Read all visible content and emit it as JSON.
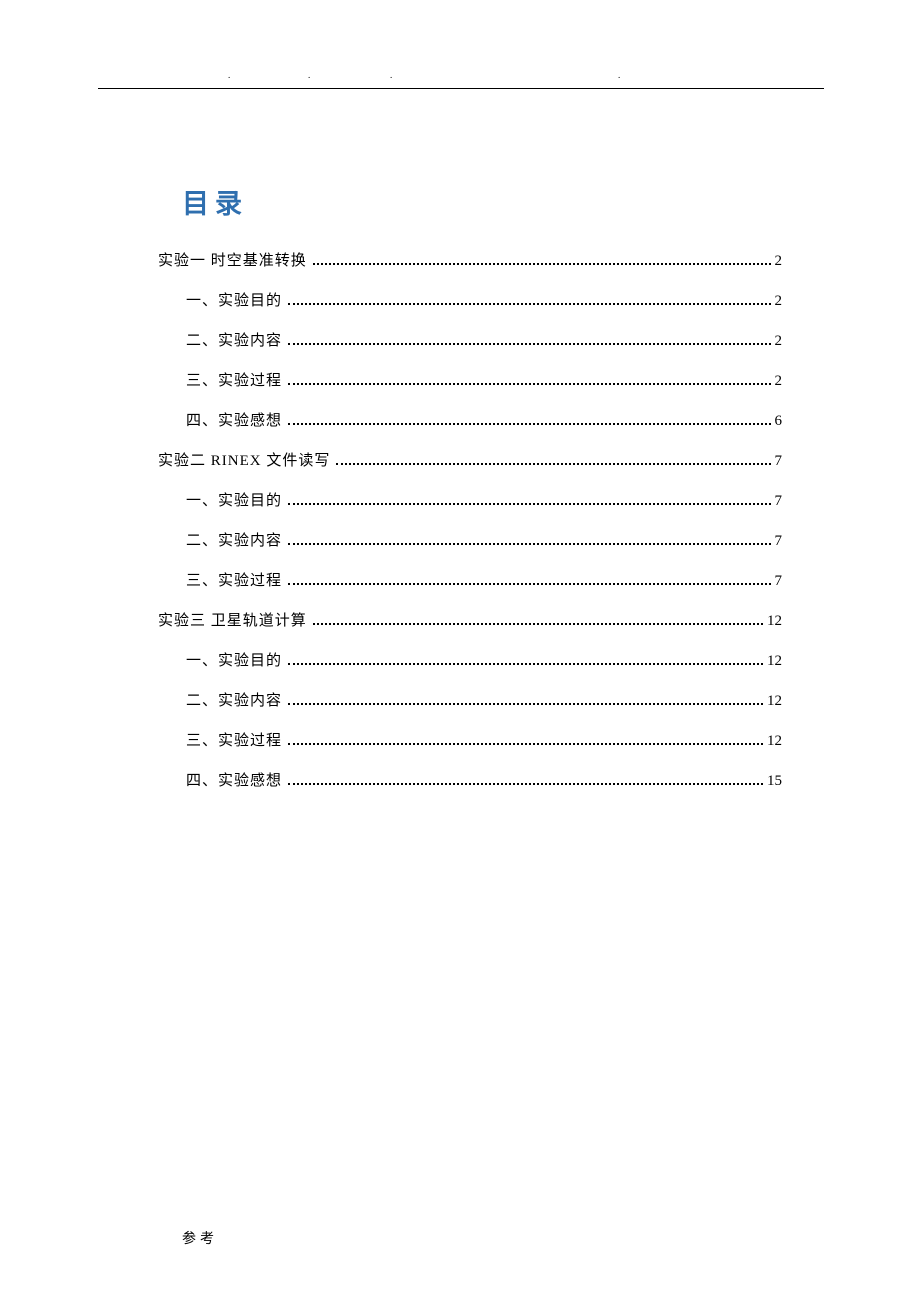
{
  "title": "目录",
  "footer": "参考",
  "toc": [
    {
      "level": 1,
      "label": "实验一  时空基准转换",
      "page": "2"
    },
    {
      "level": 2,
      "label": "一、实验目的",
      "page": "2"
    },
    {
      "level": 2,
      "label": "二、实验内容",
      "page": "2"
    },
    {
      "level": 2,
      "label": "三、实验过程",
      "page": "2"
    },
    {
      "level": 2,
      "label": "四、实验感想",
      "page": "6"
    },
    {
      "level": 1,
      "label": "实验二   RINEX 文件读写",
      "page": "7"
    },
    {
      "level": 2,
      "label": "一、实验目的",
      "page": "7"
    },
    {
      "level": 2,
      "label": "二、实验内容",
      "page": "7"
    },
    {
      "level": 2,
      "label": "三、实验过程",
      "page": "7"
    },
    {
      "level": 1,
      "label": "实验三  卫星轨道计算",
      "page": "12"
    },
    {
      "level": 2,
      "label": "一、实验目的",
      "page": "12"
    },
    {
      "level": 2,
      "label": "二、实验内容",
      "page": "12"
    },
    {
      "level": 2,
      "label": "三、实验过程",
      "page": "12"
    },
    {
      "level": 2,
      "label": "四、实验感想",
      "page": "15"
    }
  ]
}
